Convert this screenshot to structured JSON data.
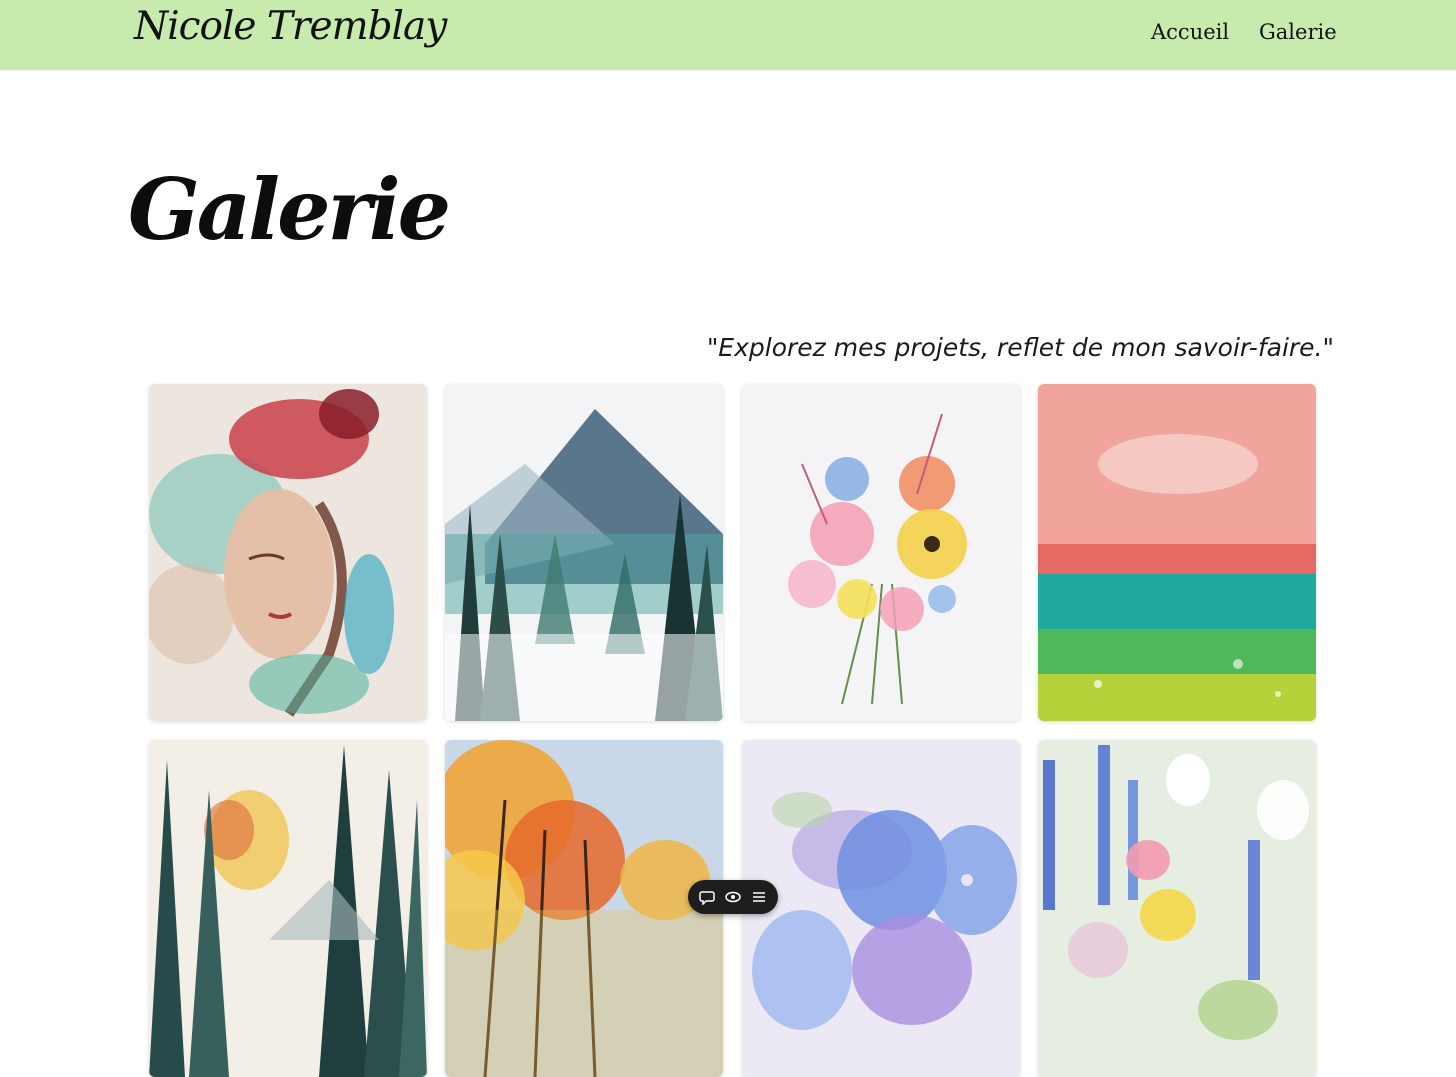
{
  "header": {
    "brand": "Nicole Tremblay",
    "nav": [
      {
        "label": "Accueil"
      },
      {
        "label": "Galerie"
      }
    ],
    "background_color": "#c6ebad"
  },
  "main": {
    "title": "Galerie",
    "tagline": "\"Explorez mes projets, reflet de mon savoir-faire.\""
  },
  "gallery": {
    "items": [
      {
        "subject": "watercolor-portrait-woman"
      },
      {
        "subject": "watercolor-misty-mountain-forest"
      },
      {
        "subject": "watercolor-flower-bouquet"
      },
      {
        "subject": "watercolor-red-sky-green-field"
      },
      {
        "subject": "watercolor-pine-forest-autumn"
      },
      {
        "subject": "watercolor-orange-autumn-trees"
      },
      {
        "subject": "watercolor-blue-hydrangea"
      },
      {
        "subject": "watercolor-wildflower-garden"
      }
    ]
  },
  "floating_toolbar": {
    "icons": [
      "comment-icon",
      "eye-icon",
      "menu-icon"
    ]
  }
}
